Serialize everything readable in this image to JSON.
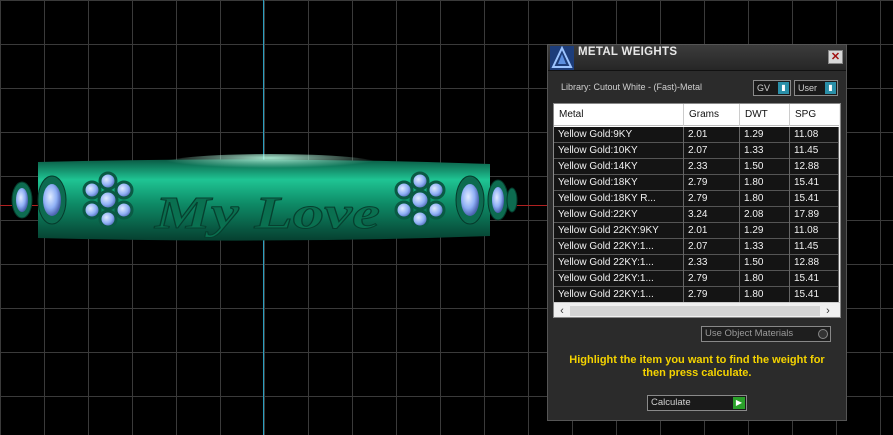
{
  "panel": {
    "title": "METAL WEIGHTS",
    "close_glyph": "✕",
    "library_label": "Library: Cutout White - (Fast)-Metal",
    "gv_button": "GV",
    "user_button": "User",
    "columns": [
      "Metal",
      "Grams",
      "DWT",
      "SPG"
    ],
    "rows": [
      [
        "Yellow Gold:9KY",
        "2.01",
        "1.29",
        "11.08"
      ],
      [
        "Yellow Gold:10KY",
        "2.07",
        "1.33",
        "11.45"
      ],
      [
        "Yellow Gold:14KY",
        "2.33",
        "1.50",
        "12.88"
      ],
      [
        "Yellow Gold:18KY",
        "2.79",
        "1.80",
        "15.41"
      ],
      [
        "Yellow Gold:18KY R...",
        "2.79",
        "1.80",
        "15.41"
      ],
      [
        "Yellow Gold:22KY",
        "3.24",
        "2.08",
        "17.89"
      ],
      [
        "Yellow Gold 22KY:9KY",
        "2.01",
        "1.29",
        "11.08"
      ],
      [
        "Yellow Gold 22KY:1...",
        "2.07",
        "1.33",
        "11.45"
      ],
      [
        "Yellow Gold 22KY:1...",
        "2.33",
        "1.50",
        "12.88"
      ],
      [
        "Yellow Gold 22KY:1...",
        "2.79",
        "1.80",
        "15.41"
      ],
      [
        "Yellow Gold 22KY:1...",
        "2.79",
        "1.80",
        "15.41"
      ]
    ],
    "use_object_materials": "Use Object Materials",
    "hint": "Highlight the item you want to find the weight for then press calculate.",
    "calculate_button": "Calculate"
  },
  "viewport": {
    "engraving": "My Love"
  },
  "colors": {
    "ring": "#0f8f6a",
    "gem": "#9ab8ff",
    "hint": "#f4d300"
  },
  "icons": [
    "app-logo-icon",
    "close-icon",
    "dropdown-arrow-icon",
    "go-arrow-icon",
    "scroll-up-icon",
    "scroll-down-icon",
    "scroll-left-icon",
    "scroll-right-icon"
  ]
}
